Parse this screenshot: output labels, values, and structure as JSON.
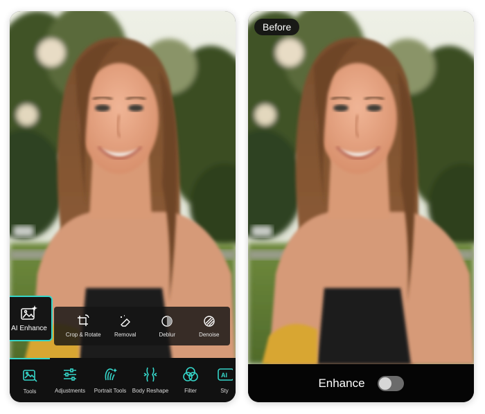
{
  "left_panel": {
    "ai_enhance_label": "AI Enhance",
    "popup_tools": [
      {
        "label": "Crop & Rotate",
        "icon": "crop-rotate-icon"
      },
      {
        "label": "Removal",
        "icon": "eraser-icon"
      },
      {
        "label": "Deblur",
        "icon": "deblur-icon"
      },
      {
        "label": "Denoise",
        "icon": "denoise-icon"
      }
    ],
    "bottom_tabs": [
      {
        "label": "Tools",
        "icon": "tools-icon",
        "active": true
      },
      {
        "label": "Adjustments",
        "icon": "sliders-icon"
      },
      {
        "label": "Portrait Tools",
        "icon": "portrait-icon"
      },
      {
        "label": "Body Reshape",
        "icon": "body-reshape-icon"
      },
      {
        "label": "Filter",
        "icon": "filter-icon"
      },
      {
        "label": "Sty",
        "icon": "ai-style-icon"
      }
    ],
    "accent_color": "#35d6c9"
  },
  "right_panel": {
    "before_badge": "Before",
    "enhance_label": "Enhance",
    "toggle_on": false
  }
}
